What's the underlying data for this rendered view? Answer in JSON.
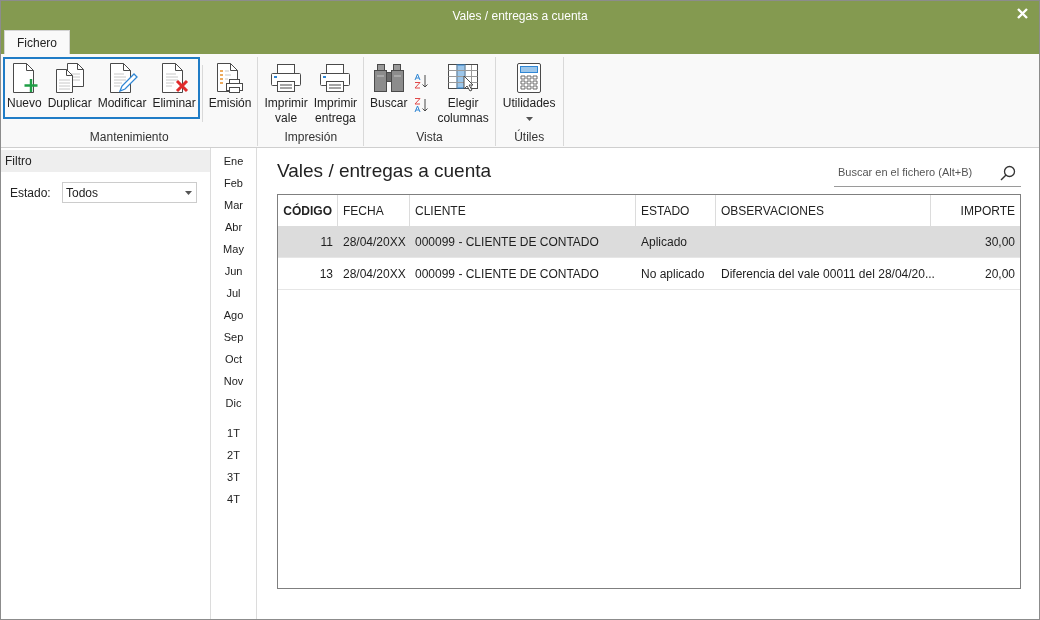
{
  "window": {
    "title": "Vales / entregas a cuenta"
  },
  "ribbon": {
    "tabs": [
      {
        "label": "Fichero",
        "selected": true
      }
    ],
    "groups": [
      {
        "label": "Mantenimiento",
        "sections": [
          {
            "highlighted": true,
            "buttons": [
              {
                "kind": "large",
                "label": "Nuevo"
              },
              {
                "kind": "large",
                "label": "Duplicar"
              },
              {
                "kind": "large",
                "label": "Modificar"
              },
              {
                "kind": "large",
                "label": "Eliminar"
              }
            ]
          },
          {
            "highlighted": false,
            "buttons": [
              {
                "kind": "large",
                "label": "Emisión"
              }
            ]
          }
        ]
      },
      {
        "label": "Impresión",
        "sections": [
          {
            "highlighted": false,
            "buttons": [
              {
                "kind": "large",
                "label": "Imprimir vale"
              },
              {
                "kind": "large",
                "label": "Imprimir entrega"
              }
            ]
          }
        ]
      },
      {
        "label": "Vista",
        "sections": [
          {
            "highlighted": false,
            "buttons": [
              {
                "kind": "large",
                "label": "Buscar"
              },
              {
                "kind": "sort-pair"
              },
              {
                "kind": "large",
                "label": "Elegir columnas"
              }
            ]
          }
        ]
      },
      {
        "label": "Útiles",
        "sections": [
          {
            "highlighted": false,
            "buttons": [
              {
                "kind": "dropdown",
                "label": "Utilidades"
              }
            ]
          }
        ]
      }
    ]
  },
  "filter": {
    "title": "Filtro",
    "fields": [
      {
        "label": "Estado:",
        "value": "Todos"
      }
    ]
  },
  "periods": {
    "months": [
      "Ene",
      "Feb",
      "Mar",
      "Abr",
      "May",
      "Jun",
      "Jul",
      "Ago",
      "Sep",
      "Oct",
      "Nov",
      "Dic"
    ],
    "quarters": [
      "1T",
      "2T",
      "3T",
      "4T"
    ]
  },
  "content": {
    "heading": "Vales / entregas a cuenta",
    "search": {
      "placeholder": "Buscar en el fichero (Alt+B)"
    }
  },
  "table": {
    "columns": [
      {
        "label": "CÓDIGO",
        "kind": "number",
        "sorted": true
      },
      {
        "label": "FECHA",
        "kind": "text",
        "sorted": false
      },
      {
        "label": "CLIENTE",
        "kind": "text",
        "sorted": false
      },
      {
        "label": "ESTADO",
        "kind": "text",
        "sorted": false
      },
      {
        "label": "OBSERVACIONES",
        "kind": "text",
        "sorted": false
      },
      {
        "label": "IMPORTE",
        "kind": "number",
        "sorted": false
      }
    ],
    "rows": [
      {
        "selected": true,
        "codigo": "11",
        "fecha": "28/04/20XX",
        "cliente": "000099 - CLIENTE DE CONTADO",
        "estado": "Aplicado",
        "importe": "30,00"
      },
      {
        "selected": false,
        "codigo": "13",
        "fecha": "28/04/20XX",
        "cliente": "000099 - CLIENTE DE CONTADO",
        "estado": "No aplicado",
        "observaciones": "Diferencia del vale 00011 del 28/04/20...",
        "importe": "20,00"
      }
    ]
  }
}
